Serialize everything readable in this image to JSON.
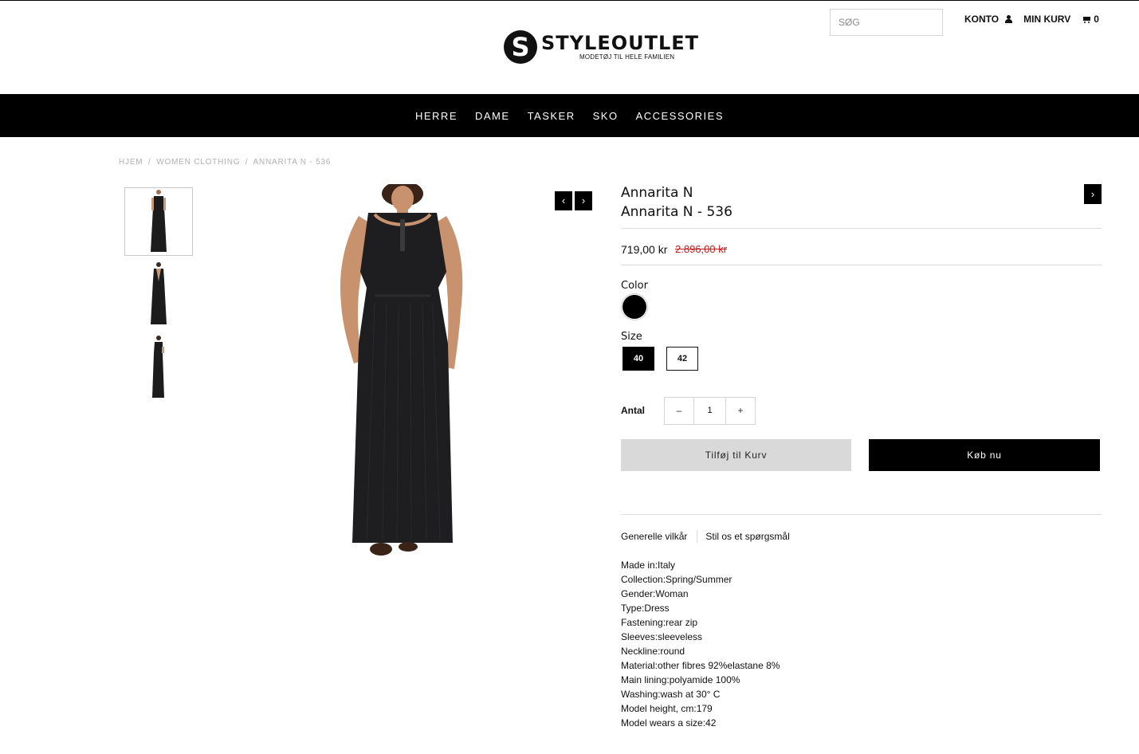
{
  "header": {
    "logo_letter": "S",
    "logo_text": "STYLEOUTLET",
    "logo_tagline": "MODETØJ TIL HELE FAMILIEN",
    "search_placeholder": "SØG",
    "account_label": "KONTO",
    "cart_label": "MIN KURV",
    "cart_count": "0"
  },
  "nav": {
    "items": [
      "HERRE",
      "DAME",
      "TASKER",
      "SKO",
      "ACCESSORIES"
    ]
  },
  "breadcrumb": {
    "home": "HJEM",
    "category": "WOMEN CLOTHING",
    "current": "ANNARITA N - 536",
    "separator": "/"
  },
  "product": {
    "brand": "Annarita N",
    "title": "Annarita N - 536",
    "price": "719,00 kr",
    "compare_price": "2.896,00 kr",
    "color_label": "Color",
    "color_value_hex": "#000000",
    "size_label": "Size",
    "sizes": [
      "40",
      "42"
    ],
    "selected_size": "40",
    "quantity_label": "Antal",
    "quantity": "1",
    "minus": "–",
    "plus": "+",
    "add_to_cart": "Tilføj til Kurv",
    "buy_now": "Køb nu",
    "tabs": [
      "Generelle vilkår",
      "Stil os et spørgsmål"
    ],
    "specs": [
      "Made in:Italy",
      "Collection:Spring/Summer",
      "Gender:Woman",
      "Type:Dress",
      "Fastening:rear zip",
      "Sleeves:sleeveless",
      "Neckline:round",
      "Material:other fibres 92%elastane 8%",
      "Main lining:polyamide 100%",
      "Washing:wash at 30° C",
      "Model height, cm:179",
      "Model wears a size:42"
    ]
  },
  "gallery": {
    "prev_icon": "‹",
    "next_icon": "›",
    "next_product_icon": "›"
  }
}
